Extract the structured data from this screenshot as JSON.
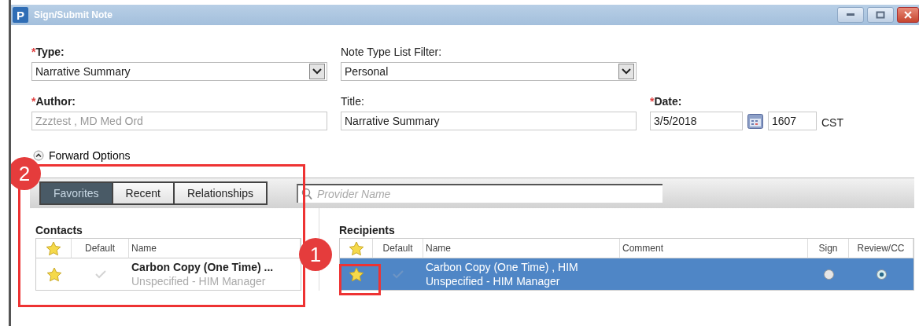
{
  "window": {
    "title": "Sign/Submit Note",
    "app_icon": "P"
  },
  "form": {
    "type": {
      "marker": "*",
      "label": "Type:",
      "value": "Narrative Summary"
    },
    "note_type_filter": {
      "label": "Note Type List Filter:",
      "value": "Personal"
    },
    "author": {
      "marker": "*",
      "label": "Author:",
      "value": "Zzztest , MD Med Ord",
      "disabled": true
    },
    "title": {
      "label": "Title:",
      "value": "Narrative Summary"
    },
    "date": {
      "marker": "*",
      "label": "Date:",
      "value": "3/5/2018",
      "time": "1607",
      "timezone": "CST"
    }
  },
  "forward_options": {
    "label": "Forward Options",
    "expanded": true
  },
  "tabs": [
    {
      "label": "Favorites",
      "selected": true
    },
    {
      "label": "Recent",
      "selected": false
    },
    {
      "label": "Relationships",
      "selected": false
    }
  ],
  "search": {
    "placeholder": "Provider Name"
  },
  "contacts": {
    "title": "Contacts",
    "columns": [
      "Default",
      "Name"
    ],
    "rows": [
      {
        "name": "Carbon Copy (One Time) ...",
        "detail": "Unspecified - HIM Manager",
        "default": false,
        "selected": false
      }
    ]
  },
  "recipients": {
    "title": "Recipients",
    "columns": [
      "Default",
      "Name",
      "Comment",
      "Sign",
      "Review/CC"
    ],
    "rows": [
      {
        "name": "Carbon Copy (One Time) , HIM",
        "detail": "Unspecified - HIM Manager",
        "default": false,
        "selected": true,
        "sign": false,
        "review_cc": true
      }
    ]
  },
  "callouts": [
    {
      "label": "2"
    },
    {
      "label": "1"
    }
  ]
}
